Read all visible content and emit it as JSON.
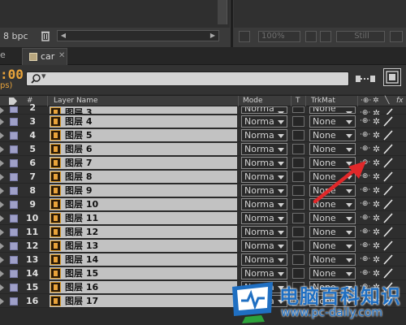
{
  "project_panel": {
    "bpc_label": "8 bpc"
  },
  "viewer": {
    "zoom": "100%",
    "quality": "Still"
  },
  "tabs": {
    "previous_tab": "e",
    "active_tab": "car"
  },
  "timeline": {
    "timecode": ":00",
    "fps": "ps)",
    "search_placeholder": ""
  },
  "columns": {
    "number": "#",
    "layer_name": "Layer Name",
    "mode": "Mode",
    "t": "T",
    "trkmat": "TrkMat",
    "fx": "fx"
  },
  "layers": [
    {
      "num": "2",
      "name": "图层 3",
      "mode": "Norma",
      "trkmat": "None"
    },
    {
      "num": "3",
      "name": "图层 4",
      "mode": "Norma",
      "trkmat": "None"
    },
    {
      "num": "4",
      "name": "图层 5",
      "mode": "Norma",
      "trkmat": "None"
    },
    {
      "num": "5",
      "name": "图层 6",
      "mode": "Norma",
      "trkmat": "None"
    },
    {
      "num": "6",
      "name": "图层 7",
      "mode": "Norma",
      "trkmat": "None"
    },
    {
      "num": "7",
      "name": "图层 8",
      "mode": "Norma",
      "trkmat": "None"
    },
    {
      "num": "8",
      "name": "图层 9",
      "mode": "Norma",
      "trkmat": "None"
    },
    {
      "num": "9",
      "name": "图层 10",
      "mode": "Norma",
      "trkmat": "None"
    },
    {
      "num": "10",
      "name": "图层 11",
      "mode": "Norma",
      "trkmat": "None"
    },
    {
      "num": "11",
      "name": "图层 12",
      "mode": "Norma",
      "trkmat": "None"
    },
    {
      "num": "12",
      "name": "图层 13",
      "mode": "Norma",
      "trkmat": "None"
    },
    {
      "num": "13",
      "name": "图层 14",
      "mode": "Norma",
      "trkmat": "None"
    },
    {
      "num": "14",
      "name": "图层 15",
      "mode": "Norma",
      "trkmat": "None"
    },
    {
      "num": "15",
      "name": "图层 16",
      "mode": "Norma",
      "trkmat": "None"
    },
    {
      "num": "16",
      "name": "图层 17",
      "mode": "Norma",
      "trkmat": "None"
    }
  ],
  "watermark": {
    "title": "电脑百科知识",
    "url": "www.pc-daily.com"
  },
  "colors": {
    "timecode": "#e8a33a",
    "label": "#9fa0c8",
    "layer_name_bg": "#c2c2c2",
    "arrow": "#e0282a",
    "watermark": "#1f6fc2"
  },
  "icons": [
    "trash-icon",
    "search-icon",
    "tab-close-icon",
    "graph-toggle-icon",
    "shy-switch-icon",
    "sun-switch-icon",
    "pen-switch-icon",
    "psd-layer-icon",
    "tag-icon"
  ]
}
